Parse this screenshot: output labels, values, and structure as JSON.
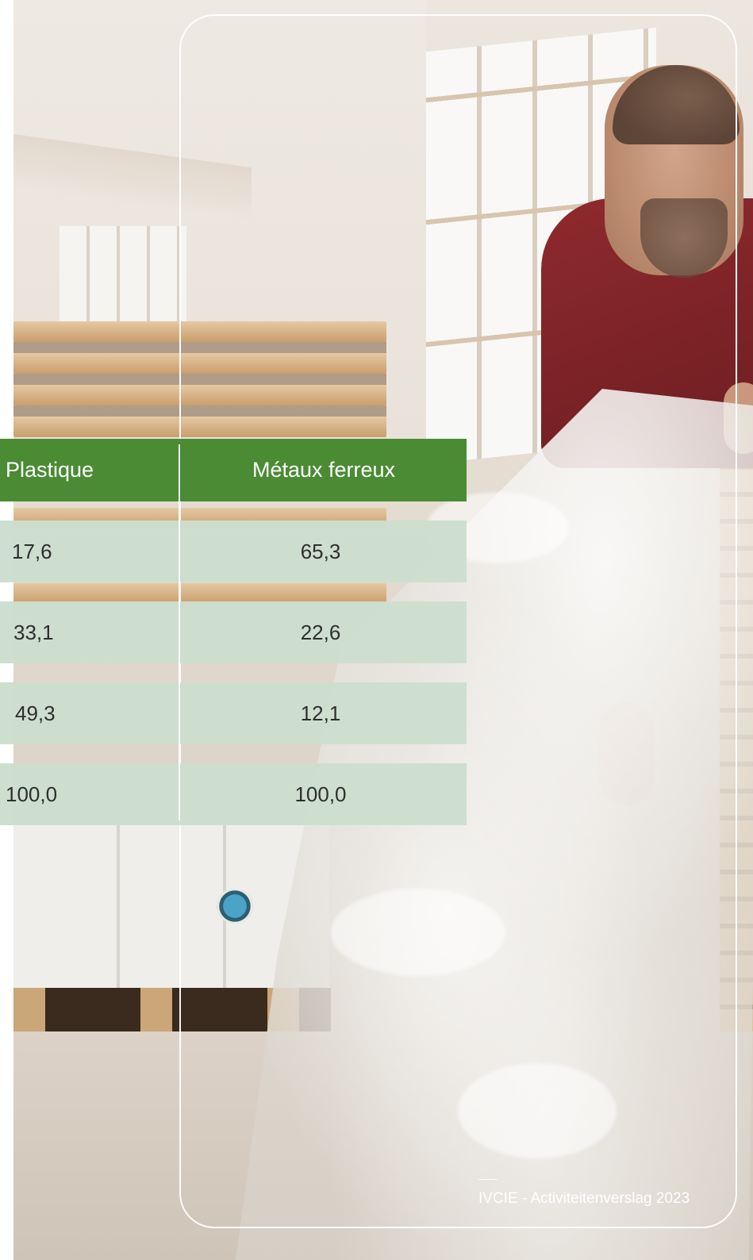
{
  "table": {
    "headers": [
      "Plastique",
      "Métaux ferreux"
    ],
    "rows": [
      [
        "17,6",
        "65,3"
      ],
      [
        "33,1",
        "22,6"
      ],
      [
        "49,3",
        "12,1"
      ],
      [
        "100,0",
        "100,0"
      ]
    ]
  },
  "footer": {
    "text": "IVCIE - Activiteitenverslag 2023"
  },
  "colors": {
    "header_green": "#4a8b34",
    "row_mint": "#ccdece",
    "frame_white": "#ffffff"
  }
}
